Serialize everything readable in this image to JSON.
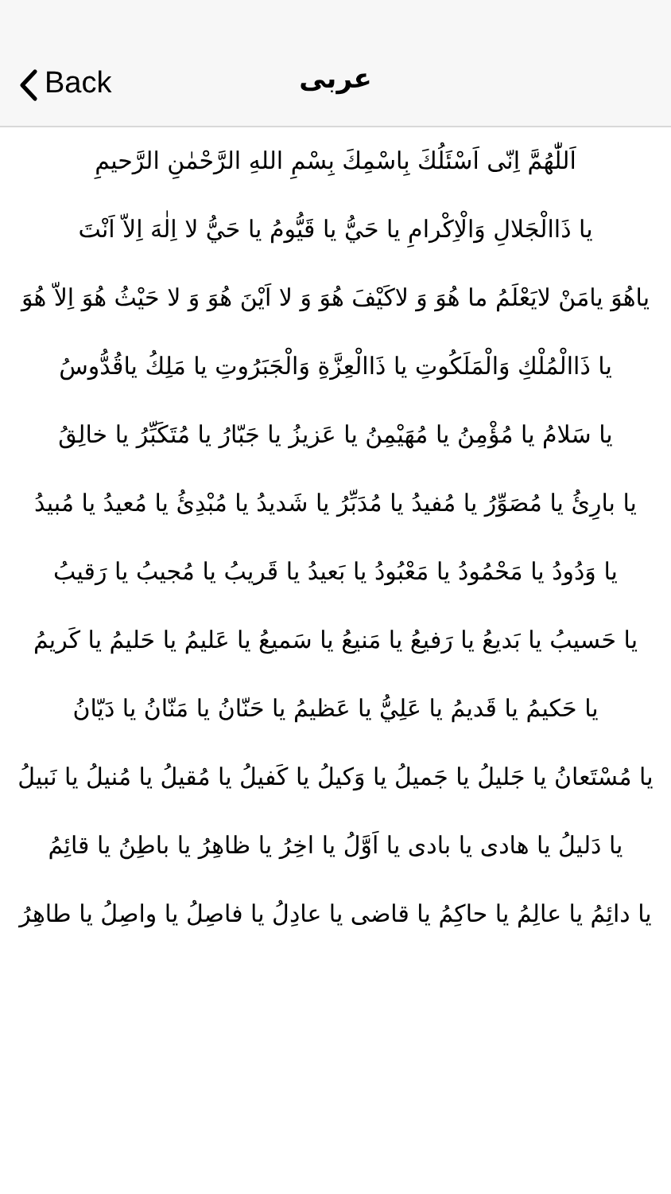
{
  "nav_bar": {
    "back_label": "Back",
    "title": "عربی"
  },
  "lines": [
    "اَللّٰهُمَّ اِنّی اَسْئَلُكَ بِاسْمِكَ بِسْمِ اللهِ الرَّحْمٰنِ الرَّحيمِ",
    "يا ذَاالْجَلالِ وَالْاِكْرامِ يا حَيُّ يا قَيُّومُ يا حَيُّ لا اِلٰهَ اِلاّ اَنْتَ",
    "ياهُوَ يامَنْ لايَعْلَمُ ما هُوَ وَ لاكَيْفَ هُوَ وَ لا اَيْنَ هُوَ وَ لا حَيْثُ هُوَ اِلاّ هُوَ",
    "يا ذَاالْمُلْكِ وَالْمَلَكُوتِ يا ذَاالْعِزَّةِ وَالْجَبَرُوتِ يا مَلِكُ ياقُدُّوسُ",
    "يا سَلامُ يا مُؤْمِنُ يا مُهَيْمِنُ يا عَزيزُ يا جَبّارُ يا مُتَكَبِّرُ يا خالِقُ",
    "يا بارِئُ يا مُصَوِّرُ يا مُفيدُ يا مُدَبِّرُ يا شَديدُ يا مُبْدِئُ يا مُعيدُ يا مُبيدُ",
    "يا وَدُودُ يا مَحْمُودُ يا مَعْبُودُ يا بَعيدُ يا قَريبُ يا مُجيبُ يا رَقيبُ",
    "يا حَسيبُ يا بَديعُ يا رَفيعُ يا مَنيعُ يا سَميعُ يا عَليمُ يا حَليمُ يا كَريمُ",
    "يا حَكيمُ يا قَديمُ يا عَلِيُّ يا عَظيمُ يا حَنّانُ يا مَنّانُ يا دَيّانُ",
    "يا مُسْتَعانُ يا جَليلُ يا جَميلُ يا وَكيلُ يا كَفيلُ يا مُقيلُ يا مُنيلُ يا نَبيلُ",
    "يا دَليلُ يا هادی يا بادی يا اَوَّلُ يا اخِرُ يا ظاهِرُ يا باطِنُ يا قائِمُ",
    "يا دائِمُ يا عالِمُ يا حاكِمُ يا قاضی يا عادِلُ يا فاصِلُ يا واصِلُ يا طاهِرُ"
  ]
}
